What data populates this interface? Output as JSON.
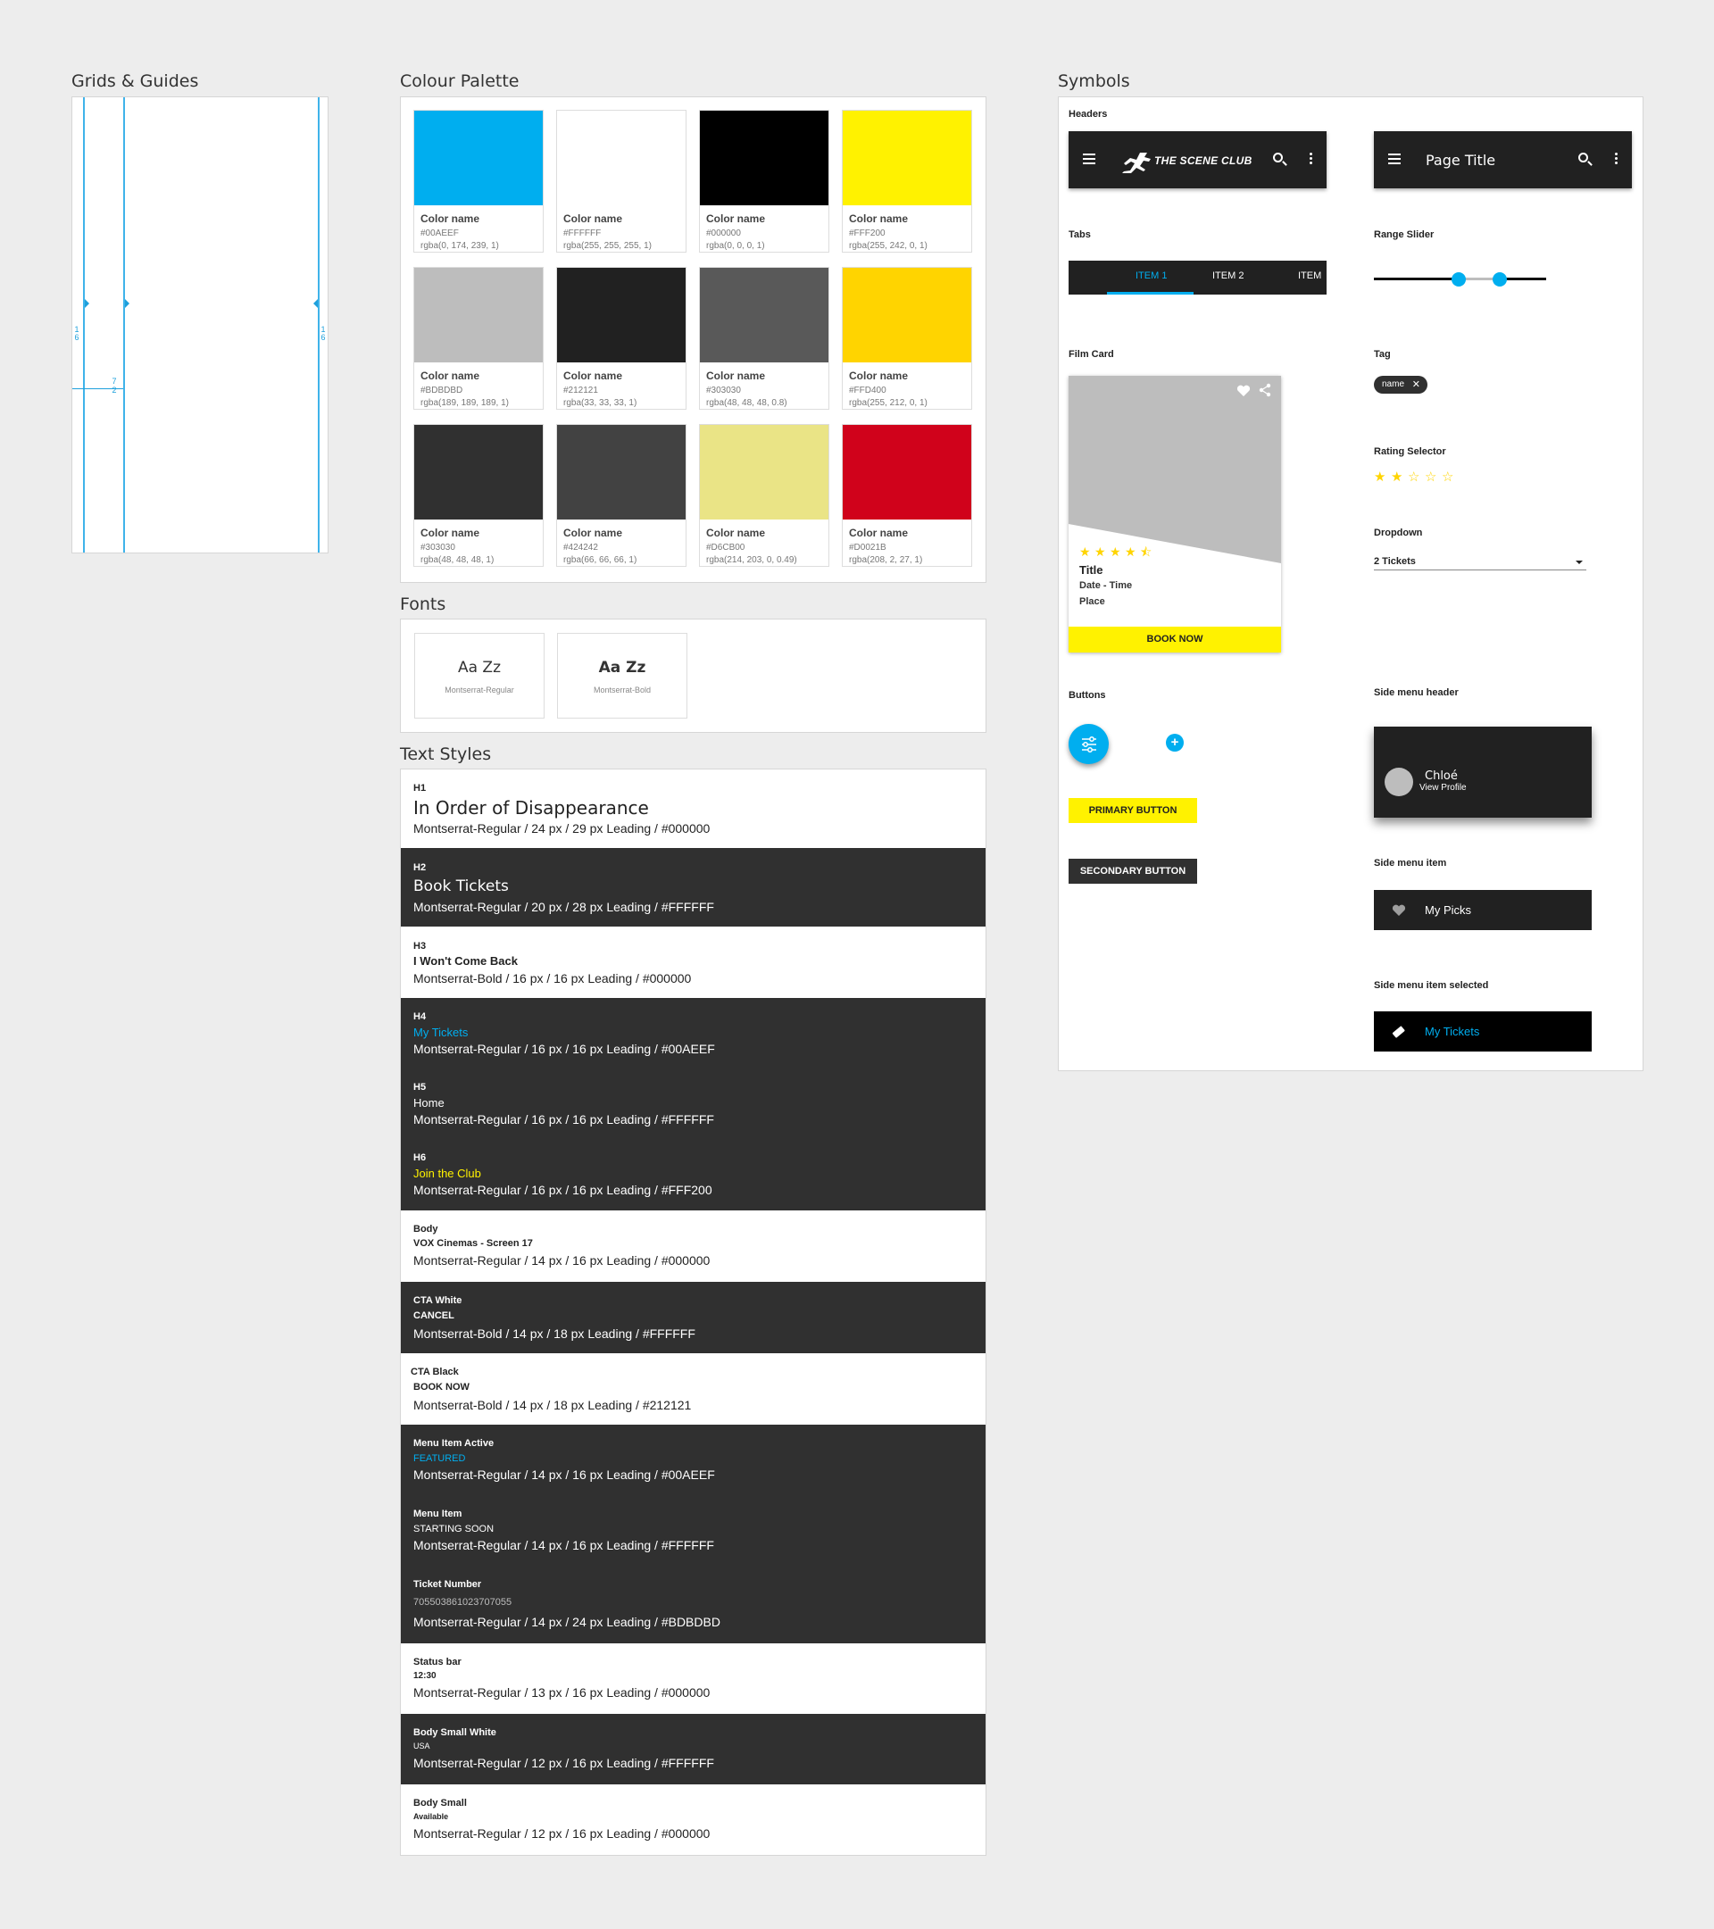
{
  "sections": {
    "grids": "Grids & Guides",
    "palette": "Colour Palette",
    "fonts": "Fonts",
    "text_styles": "Text Styles",
    "symbols": "Symbols"
  },
  "grid": {
    "marks": [
      "1",
      "6",
      "1",
      "6",
      "7",
      "2"
    ]
  },
  "palette": [
    {
      "name": "Color name",
      "hex": "#00AEEF",
      "rgba": "rgba(0, 174, 239, 1)",
      "color": "#00AEEF"
    },
    {
      "name": "Color name",
      "hex": "#FFFFFF",
      "rgba": "rgba(255, 255, 255, 1)",
      "color": "#FFFFFF"
    },
    {
      "name": "Color name",
      "hex": "#000000",
      "rgba": "rgba(0, 0, 0, 1)",
      "color": "#000000"
    },
    {
      "name": "Color name",
      "hex": "#FFF200",
      "rgba": "rgba(255, 242, 0, 1)",
      "color": "#FFF200"
    },
    {
      "name": "Color name",
      "hex": "#BDBDBD",
      "rgba": "rgba(189, 189, 189, 1)",
      "color": "#BDBDBD"
    },
    {
      "name": "Color name",
      "hex": "#212121",
      "rgba": "rgba(33, 33, 33, 1)",
      "color": "#212121"
    },
    {
      "name": "Color name",
      "hex": "#303030",
      "rgba": "rgba(48, 48, 48, 0.8)",
      "color": "#595959"
    },
    {
      "name": "Color name",
      "hex": "#FFD400",
      "rgba": "rgba(255, 212, 0, 1)",
      "color": "#FFD400"
    },
    {
      "name": "Color name",
      "hex": "#303030",
      "rgba": "rgba(48, 48, 48, 1)",
      "color": "#303030"
    },
    {
      "name": "Color name",
      "hex": "#424242",
      "rgba": "rgba(66, 66, 66, 1)",
      "color": "#424242"
    },
    {
      "name": "Color name",
      "hex": "#D6CB00",
      "rgba": "rgba(214, 203, 0, 0.49)",
      "color": "#EAE486"
    },
    {
      "name": "Color name",
      "hex": "#D0021B",
      "rgba": "rgba(208, 2, 27, 1)",
      "color": "#D0021B"
    }
  ],
  "fonts": [
    {
      "sample": "Aa Zz",
      "name": "Montserrat-Regular"
    },
    {
      "sample": "Aa Zz",
      "name": "Montserrat-Bold"
    }
  ],
  "text_styles": [
    {
      "label": "H1",
      "sample": "In Order of Disappearance",
      "spec": "Montserrat-Regular / 24 px / 29 px Leading / #000000",
      "sample_color": "#000000"
    },
    {
      "label": "H2",
      "sample": "Book Tickets",
      "spec": "Montserrat-Regular / 20 px / 28 px Leading / #FFFFFF",
      "sample_color": "#FFFFFF"
    },
    {
      "label": "H3",
      "sample": "I Won't Come Back",
      "spec": "Montserrat-Bold / 16 px / 16 px Leading / #000000",
      "sample_color": "#000000"
    },
    {
      "label": "H4",
      "sample": "My Tickets",
      "spec": "Montserrat-Regular / 16 px / 16 px Leading / #00AEEF",
      "sample_color": "#00AEEF"
    },
    {
      "label": "H5",
      "sample": "Home",
      "spec": "Montserrat-Regular / 16 px / 16 px Leading / #FFFFFF",
      "sample_color": "#FFFFFF"
    },
    {
      "label": "H6",
      "sample": "Join the Club",
      "spec": "Montserrat-Regular / 16 px / 16 px Leading / #FFF200",
      "sample_color": "#FFF200"
    },
    {
      "label": "Body",
      "sample": "VOX Cinemas - Screen 17",
      "spec": "Montserrat-Regular / 14 px / 16 px Leading / #000000",
      "sample_color": "#000000"
    },
    {
      "label": "CTA White",
      "sample": "CANCEL",
      "spec": "Montserrat-Bold / 14 px / 18 px Leading / #FFFFFF",
      "sample_color": "#FFFFFF"
    },
    {
      "label": "CTA Black",
      "sample": "BOOK NOW",
      "spec": "Montserrat-Bold / 14 px / 18 px Leading / #212121",
      "sample_color": "#000000"
    },
    {
      "label": "Menu Item Active",
      "sample": "FEATURED",
      "spec": "Montserrat-Regular / 14 px / 16 px Leading / #00AEEF",
      "sample_color": "#00AEEF"
    },
    {
      "label": "Menu Item",
      "sample": "STARTING SOON",
      "spec": "Montserrat-Regular / 14 px / 16 px Leading / #FFFFFF",
      "sample_color": "#FFFFFF"
    },
    {
      "label": "Ticket Number",
      "sample": "705503861023707055",
      "spec": "Montserrat-Regular / 14 px / 24 px Leading / #BDBDBD",
      "sample_color": "#BDBDBD"
    },
    {
      "label": "Status bar",
      "sample": "12:30",
      "spec": "Montserrat-Regular / 13 px / 16 px Leading / #000000",
      "sample_color": "#000000"
    },
    {
      "label": "Body Small White",
      "sample": "USA",
      "spec": "Montserrat-Regular / 12 px / 16 px Leading / #FFFFFF",
      "sample_color": "#FFFFFF"
    },
    {
      "label": "Body Small",
      "sample": "Available",
      "spec": "Montserrat-Regular / 12 px / 16 px Leading / #000000",
      "sample_color": "#000000"
    }
  ],
  "symbols": {
    "headers_label": "Headers",
    "brand": "THE SCENE CLUB",
    "page_title": "Page Title",
    "tabs_label": "Tabs",
    "tabs": [
      "ITEM 1",
      "ITEM 2",
      "ITEM"
    ],
    "range_slider_label": "Range Slider",
    "range_slider": {
      "low_fraction": 0.49,
      "high_fraction": 0.73
    },
    "film_card_label": "Film Card",
    "film_card": {
      "rating": 4.5,
      "title": "Title",
      "date_time": "Date - Time",
      "place": "Place",
      "cta": "BOOK NOW"
    },
    "tag_label": "Tag",
    "tag": "name",
    "rating_selector_label": "Rating Selector",
    "rating_selector": {
      "rating": 2,
      "max": 5
    },
    "dropdown_label": "Dropdown",
    "dropdown_value": "2 Tickets",
    "buttons_label": "Buttons",
    "primary_button": "PRIMARY BUTTON",
    "secondary_button": "SECONDARY BUTTON",
    "side_menu_header_label": "Side menu header",
    "profile_name": "Chloé",
    "profile_link": "View Profile",
    "side_menu_item_label": "Side menu item",
    "side_menu_item": "My Picks",
    "side_menu_item_selected_label": "Side menu item selected",
    "side_menu_item_selected": "My Tickets"
  },
  "colors": {
    "accent": "#00AEEF",
    "yellow": "#FFF200",
    "star": "#FFD400",
    "dark": "#212121",
    "dark2": "#303030",
    "gray": "#BDBDBD"
  }
}
